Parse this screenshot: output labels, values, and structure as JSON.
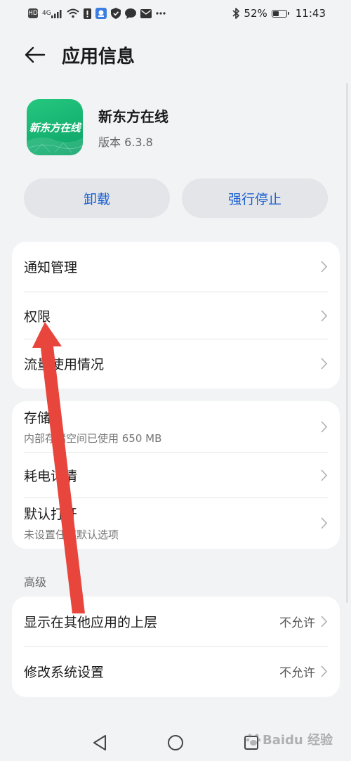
{
  "status_bar": {
    "net_label": "4G",
    "battery_percent": "52%",
    "time": "11:43",
    "battery_level": 0.52,
    "icons": [
      "hd-icon",
      "signal-icon",
      "wifi-icon",
      "notification-icon",
      "app-icon",
      "shield-icon",
      "chat-icon",
      "mail-icon",
      "more-icon",
      "bluetooth-icon",
      "battery-icon"
    ]
  },
  "header": {
    "title": "应用信息"
  },
  "app": {
    "icon_text": "新东方在线",
    "name": "新东方在线",
    "version": "版本 6.3.8",
    "icon_color": "#16b573"
  },
  "actions": {
    "uninstall": "卸载",
    "force_stop": "强行停止",
    "accent_color": "#1b5fd1"
  },
  "group1": {
    "items": [
      {
        "label": "通知管理"
      },
      {
        "label": "权限"
      },
      {
        "label": "流量使用情况"
      }
    ]
  },
  "group2": {
    "items": [
      {
        "label": "存储",
        "sub": "内部存储空间已使用 650 MB"
      },
      {
        "label": "耗电详情"
      },
      {
        "label": "默认打开",
        "sub": "未设置任何默认选项"
      }
    ]
  },
  "advanced": {
    "section_label": "高级",
    "items": [
      {
        "label": "显示在其他应用的上层",
        "value": "不允许"
      },
      {
        "label": "修改系统设置",
        "value": "不允许"
      }
    ]
  },
  "watermark": {
    "text": "Baidu 经验"
  },
  "annotation": {
    "color": "#e8453c"
  }
}
